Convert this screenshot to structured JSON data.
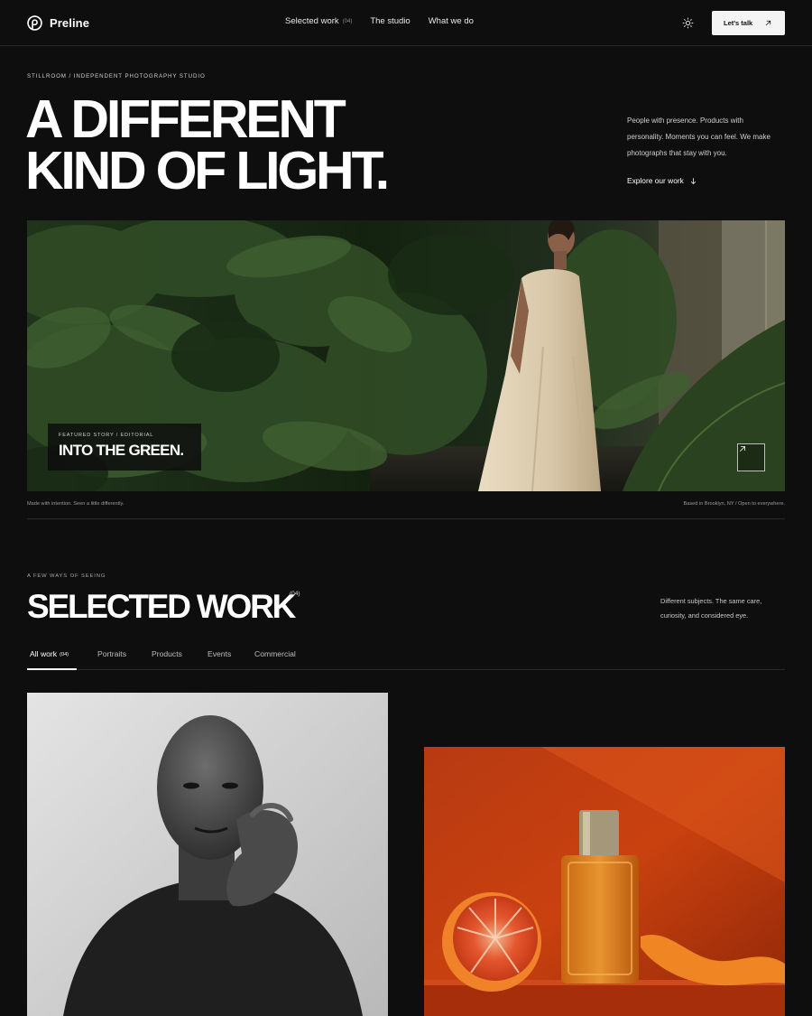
{
  "brand": {
    "name": "Preline",
    "logo_icon": "preline-logo-icon"
  },
  "nav": {
    "items": [
      {
        "label": "Selected work",
        "count": "(04)"
      },
      {
        "label": "The studio"
      },
      {
        "label": "What we do"
      }
    ],
    "theme_toggle_icon": "sun-icon",
    "cta_label": "Let's talk",
    "cta_icon": "arrow-up-right-icon"
  },
  "hero": {
    "eyebrow": "STILLROOM / INDEPENDENT PHOTOGRAPHY STUDIO",
    "title_line_1": "A DIFFERENT",
    "title_line_2": "KIND OF LIGHT.",
    "description": "People with presence. Products with personality. Moments you can feel. We make photographs that stay with you.",
    "explore_label": "Explore our work",
    "explore_icon": "arrow-down-icon"
  },
  "featured": {
    "label": "FEATURED STORY / EDITORIAL",
    "title": "INTO THE GREEN.",
    "arrow_icon": "arrow-up-right-icon",
    "meta_left": "Made with intention. Seen a little differently.",
    "meta_right": "Based in Brooklyn, NY / Open to everywhere."
  },
  "work": {
    "eyebrow": "A FEW WAYS OF SEEING",
    "title": "SELECTED WORK",
    "count": "(04)",
    "description": "Different subjects. The same care, curiosity, and considered eye.",
    "tabs": [
      {
        "label": "All work",
        "count": "(04)",
        "active": true
      },
      {
        "label": "Portraits"
      },
      {
        "label": "Products"
      },
      {
        "label": "Events"
      },
      {
        "label": "Commercial"
      }
    ]
  },
  "colors": {
    "background": "#0e0e0e",
    "text": "#f2f2f2",
    "accent_orange": "#c9410f"
  }
}
